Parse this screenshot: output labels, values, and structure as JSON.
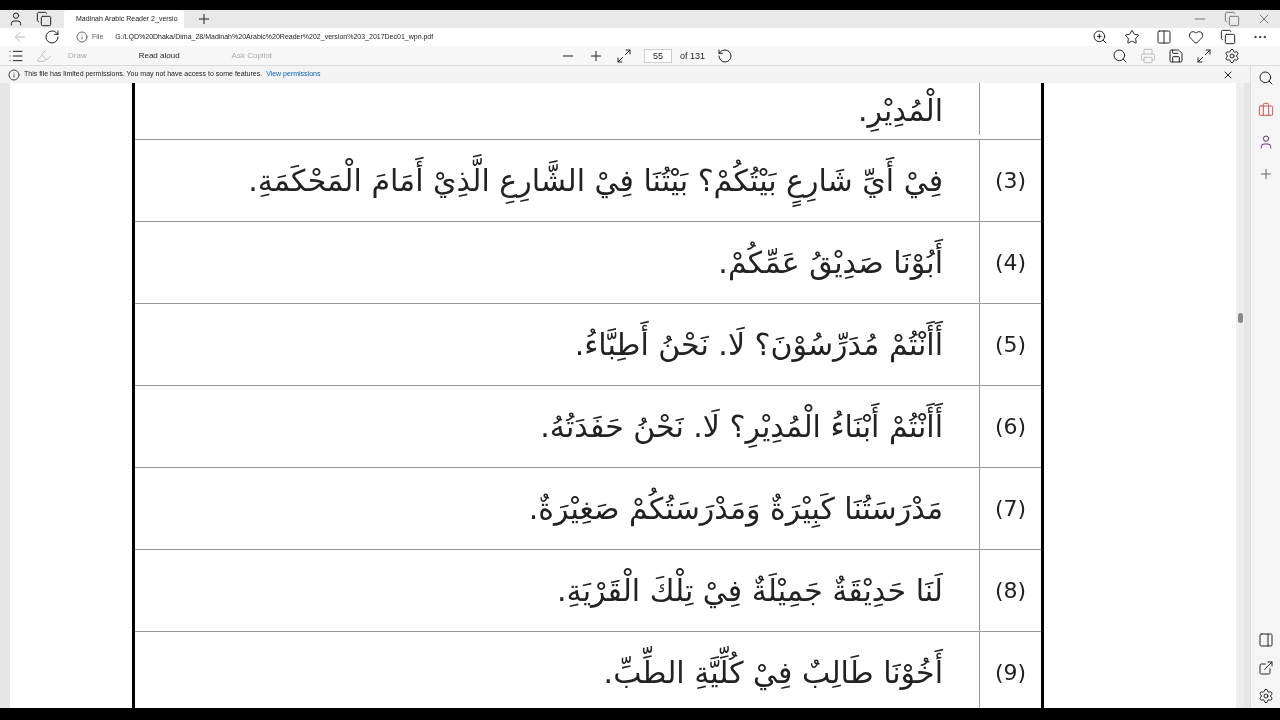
{
  "browser": {
    "tab_title": "Madinah Arabic Reader 2_versio",
    "address_label": "File",
    "address": "G:/LQD%20Dhaka/Dima_28/Madinah%20Arabic%20Reader%202_version%203_2017Dec01_wpn.pdf"
  },
  "pdf_toolbar": {
    "draw": {
      "label": "Draw",
      "disabled": true
    },
    "read_aloud": {
      "label": "Read aloud",
      "disabled": false
    },
    "ask_copilot": {
      "label": "Ask Copilot",
      "disabled": true
    },
    "page_number": "55",
    "page_total": "of 131"
  },
  "info_bar": {
    "message": "This file has limited permissions. You may not have access to some features.",
    "link": "View permissions"
  },
  "table": {
    "rows": [
      {
        "number": "",
        "text": "الْمُدِيْرِ."
      },
      {
        "number": "(3)",
        "text": "فِيْ أَيِّ شَارِعٍ بَيْتُكُمْ؟ بَيْتُنَا فِيْ الشَّارِعِ الَّذِيْ أَمَامَ الْمَحْكَمَةِ."
      },
      {
        "number": "(4)",
        "text": "أَبُوْنَا صَدِيْقُ عَمِّكُمْ."
      },
      {
        "number": "(5)",
        "text": "أَأَنْتُمْ مُدَرِّسُوْنَ؟ لَا. نَحْنُ أَطِبَّاءُ."
      },
      {
        "number": "(6)",
        "text": "أَأَنْتُمْ أَبْنَاءُ الْمُدِيْرِ؟ لَا. نَحْنُ حَفَدَتُهُ."
      },
      {
        "number": "(7)",
        "text": "مَدْرَسَتُنَا كَبِيْرَةٌ وَمَدْرَسَتُكُمْ صَغِيْرَةٌ."
      },
      {
        "number": "(8)",
        "text": "لَنَا حَدِيْقَةٌ جَمِيْلَةٌ فِيْ تِلْكَ الْقَرْيَةِ."
      },
      {
        "number": "(9)",
        "text": "أَخُوْنَا طَالِبٌ فِيْ كُلِّيَّةِ الطِّبِّ."
      }
    ]
  }
}
